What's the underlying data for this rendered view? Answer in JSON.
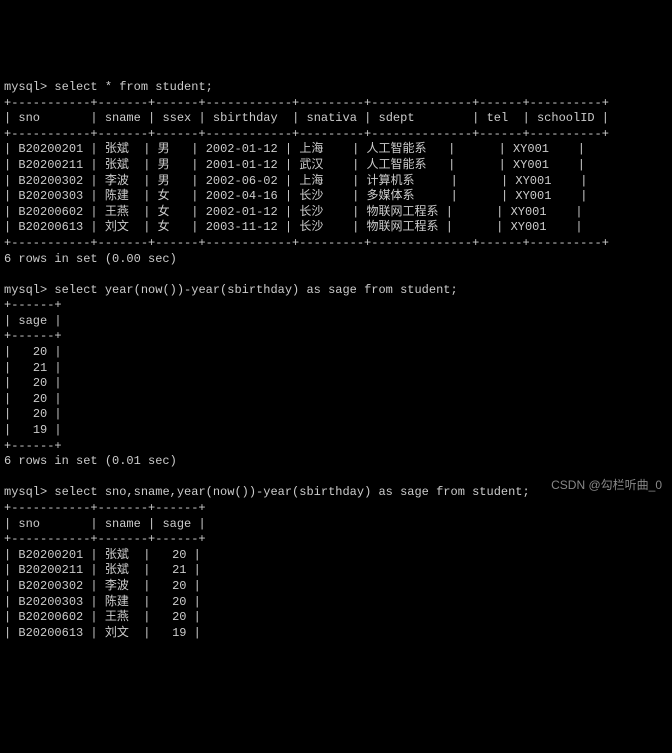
{
  "prompt": "mysql>",
  "queries": {
    "q1": "select * from student;",
    "q2": "select year(now())-year(sbirthday) as sage from student;",
    "q3": "select sno,sname,year(now())-year(sbirthday) as sage from student;"
  },
  "table1": {
    "headers": [
      "sno",
      "sname",
      "ssex",
      "sbirthday",
      "snativa",
      "sdept",
      "tel",
      "schoolID"
    ],
    "rows": [
      [
        "B20200201",
        "张斌",
        "男",
        "2002-01-12",
        "上海",
        "人工智能系",
        "",
        "XY001"
      ],
      [
        "B20200211",
        "张斌",
        "男",
        "2001-01-12",
        "武汉",
        "人工智能系",
        "",
        "XY001"
      ],
      [
        "B20200302",
        "李波",
        "男",
        "2002-06-02",
        "上海",
        "计算机系",
        "",
        "XY001"
      ],
      [
        "B20200303",
        "陈建",
        "女",
        "2002-04-16",
        "长沙",
        "多媒体系",
        "",
        "XY001"
      ],
      [
        "B20200602",
        "王燕",
        "女",
        "2002-01-12",
        "长沙",
        "物联网工程系",
        "",
        "XY001"
      ],
      [
        "B20200613",
        "刘文",
        "女",
        "2003-11-12",
        "长沙",
        "物联网工程系",
        "",
        "XY001"
      ]
    ],
    "footer": "6 rows in set (0.00 sec)"
  },
  "table2": {
    "headers": [
      "sage"
    ],
    "rows": [
      [
        "20"
      ],
      [
        "21"
      ],
      [
        "20"
      ],
      [
        "20"
      ],
      [
        "20"
      ],
      [
        "19"
      ]
    ],
    "footer": "6 rows in set (0.01 sec)"
  },
  "table3": {
    "headers": [
      "sno",
      "sname",
      "sage"
    ],
    "rows": [
      [
        "B20200201",
        "张斌",
        "20"
      ],
      [
        "B20200211",
        "张斌",
        "21"
      ],
      [
        "B20200302",
        "李波",
        "20"
      ],
      [
        "B20200303",
        "陈建",
        "20"
      ],
      [
        "B20200602",
        "王燕",
        "20"
      ],
      [
        "B20200613",
        "刘文",
        "19"
      ]
    ]
  },
  "watermark": "CSDN @勾栏听曲_0"
}
